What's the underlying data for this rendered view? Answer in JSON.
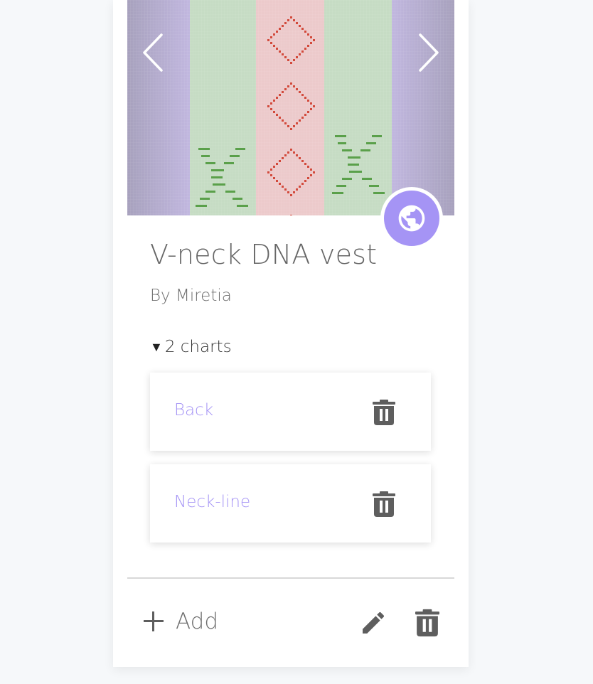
{
  "pattern": {
    "title": "V-neck DNA vest",
    "author": "By Miretia",
    "visibility_icon": "globe-icon"
  },
  "carousel": {
    "prev_icon": "chevron-left-icon",
    "next_icon": "chevron-right-icon"
  },
  "charts": {
    "toggle_symbol": "▼",
    "toggle_label": "2 charts",
    "items": [
      {
        "label": "Back",
        "delete_icon": "trash-icon"
      },
      {
        "label": "Neck-line",
        "delete_icon": "trash-icon"
      }
    ]
  },
  "footer": {
    "add_label": "Add",
    "edit_icon": "pencil-icon",
    "delete_icon": "trash-icon"
  },
  "colors": {
    "accent": "#a594f5",
    "purple_band": "#b9b0d4",
    "green_band": "#c5dbc3",
    "pink_band": "#eac9ca",
    "red_stitch": "#d24a3c",
    "green_stitch": "#5aa04a"
  }
}
